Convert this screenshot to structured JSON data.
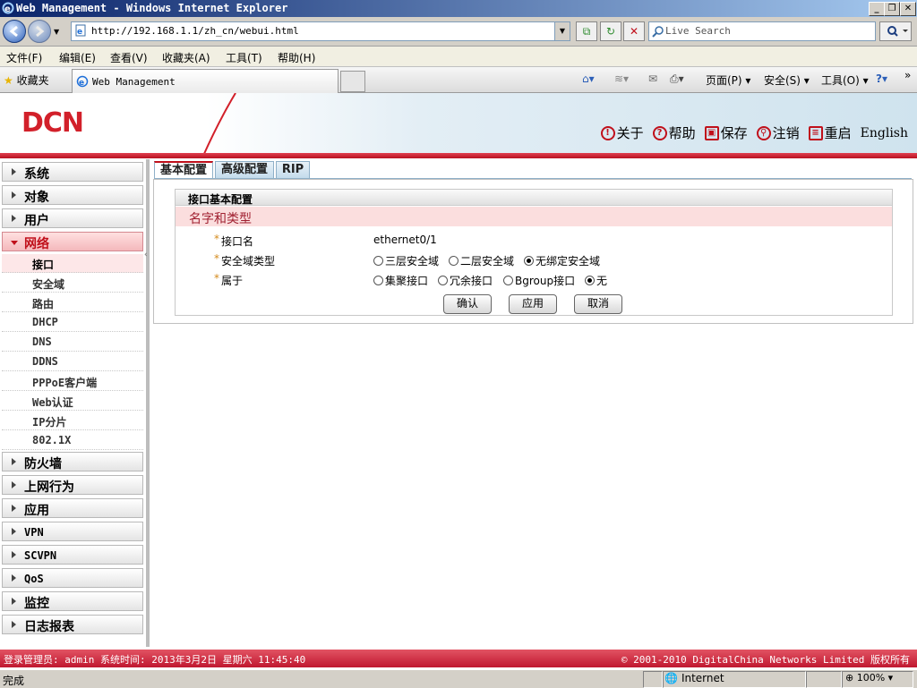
{
  "browser": {
    "window_title": "Web Management - Windows Internet Explorer",
    "address": "http://192.168.1.1/zh_cn/webui.html",
    "search_placeholder": "Live Search",
    "menu": [
      "文件(F)",
      "编辑(E)",
      "查看(V)",
      "收藏夹(A)",
      "工具(T)",
      "帮助(H)"
    ],
    "favorites_label": "收藏夹",
    "tab_title": "Web Management",
    "command_bar": {
      "page": "页面(P)",
      "safety": "安全(S)",
      "tools": "工具(O)"
    },
    "status_text": "完成",
    "zone_text": "Internet",
    "zoom_text": "100%"
  },
  "header": {
    "logo": "DCN",
    "links": [
      {
        "label": "关于",
        "glyph": "!",
        "icon": "about-icon"
      },
      {
        "label": "帮助",
        "glyph": "?",
        "icon": "help-icon"
      },
      {
        "label": "保存",
        "glyph": "▣",
        "icon": "save-icon"
      },
      {
        "label": "注销",
        "glyph": "⚲",
        "icon": "logout-icon"
      },
      {
        "label": "重启",
        "glyph": "≡",
        "icon": "restart-icon"
      }
    ],
    "language": "English"
  },
  "sidebar": {
    "sections_top": [
      "系统",
      "对象",
      "用户"
    ],
    "open_section": "网络",
    "sub_items": [
      "接口",
      "安全域",
      "路由",
      "DHCP",
      "DNS",
      "DDNS",
      "PPPoE客户端",
      "Web认证",
      "IP分片",
      "802.1X"
    ],
    "active_sub": "接口",
    "sections_bottom": [
      "防火墙",
      "上网行为",
      "应用",
      "VPN",
      "SCVPN",
      "QoS",
      "监控",
      "日志报表"
    ]
  },
  "main": {
    "tabs": [
      "基本配置",
      "高级配置",
      "RIP"
    ],
    "active_tab": "基本配置",
    "fieldset_title": "接口基本配置",
    "group_title": "名字和类型",
    "fields": {
      "name_label": "接口名",
      "name_value": "ethernet0/1",
      "zone_type_label": "安全域类型",
      "zone_type_options": [
        "三层安全域",
        "二层安全域",
        "无绑定安全域"
      ],
      "zone_type_selected": "无绑定安全域",
      "belongs_label": "属于",
      "belongs_options": [
        "集聚接口",
        "冗余接口",
        "Bgroup接口",
        "无"
      ],
      "belongs_selected": "无",
      "required_mark": "*"
    },
    "buttons": {
      "ok": "确认",
      "apply": "应用",
      "cancel": "取消"
    }
  },
  "footer": {
    "left": "登录管理员: admin 系统时间: 2013年3月2日 星期六 11:45:40",
    "right": "© 2001-2010 DigitalChina Networks Limited 版权所有"
  }
}
